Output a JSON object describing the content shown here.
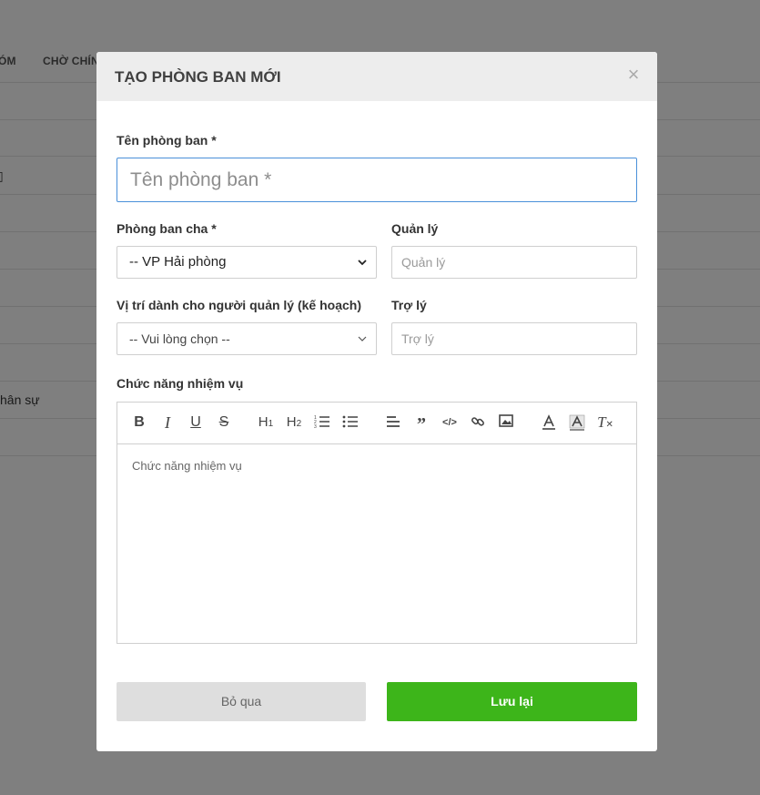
{
  "background": {
    "tabs": [
      "ÓM",
      "CHỜ CHÍN"
    ],
    "rows": [
      "",
      "",
      "",
      "",
      "",
      "",
      "",
      "hân sự",
      ""
    ]
  },
  "modal": {
    "title": "TẠO PHÒNG BAN MỚI",
    "close_glyph": "×",
    "department_name": {
      "label": "Tên phòng ban *",
      "placeholder": "Tên phòng ban *",
      "value": ""
    },
    "parent_department": {
      "label": "Phòng ban cha *",
      "selected": "-- VP Hải phòng"
    },
    "manager": {
      "label": "Quản lý",
      "placeholder": "Quản lý"
    },
    "manager_position": {
      "label": "Vị trí dành cho người quản lý (kế hoạch)",
      "selected": "-- Vui lòng chọn --"
    },
    "assistant": {
      "label": "Trợ lý",
      "placeholder": "Trợ lý"
    },
    "duties": {
      "label": "Chức năng nhiệm vụ",
      "placeholder": "Chức năng nhiệm vụ",
      "toolbar": [
        "bold-icon",
        "italic-icon",
        "underline-icon",
        "strike-icon",
        "heading1-icon",
        "heading2-icon",
        "ordered-list-icon",
        "bullet-list-icon",
        "align-icon",
        "blockquote-icon",
        "code-icon",
        "link-icon",
        "image-icon",
        "text-color-icon",
        "background-color-icon",
        "clear-format-icon"
      ]
    },
    "cancel_label": "Bỏ qua",
    "save_label": "Lưu lại"
  },
  "colors": {
    "accent_save": "#3db51a",
    "focus_border": "#4a90d9",
    "header_bg": "#ededed"
  }
}
